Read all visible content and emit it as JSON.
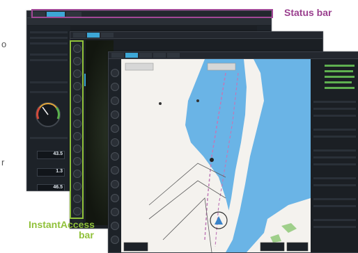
{
  "callouts": {
    "status_bar": "Status bar",
    "instant_access_line1": "InstantAccess",
    "instant_access_line2": "bar"
  },
  "back_window": {
    "readouts": [
      "43.5",
      "1.3",
      "46.5"
    ]
  },
  "colors": {
    "status_callout": "#9a3f8e",
    "instant_callout": "#90c13a",
    "water": "#6ab4e6",
    "land": "#f4f2ee",
    "panel": "#1b1f24"
  }
}
